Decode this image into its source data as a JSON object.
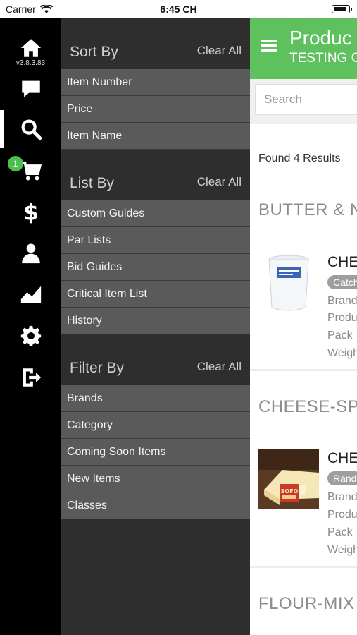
{
  "status_bar": {
    "carrier": "Carrier",
    "time": "6:45 CH"
  },
  "rail": {
    "version": "v3.8.3.83",
    "cart_badge": "1",
    "items": [
      {
        "icon": "home-icon"
      },
      {
        "icon": "chat-icon"
      },
      {
        "icon": "search-icon"
      },
      {
        "icon": "cart-icon"
      },
      {
        "icon": "dollar-icon"
      },
      {
        "icon": "user-icon"
      },
      {
        "icon": "chart-icon"
      },
      {
        "icon": "gear-icon"
      },
      {
        "icon": "logout-icon"
      }
    ]
  },
  "menu": {
    "sort_by": {
      "title": "Sort By",
      "clear": "Clear All",
      "items": [
        "Item Number",
        "Price",
        "Item Name"
      ]
    },
    "list_by": {
      "title": "List By",
      "clear": "Clear All",
      "items": [
        "Custom Guides",
        "Par Lists",
        "Bid Guides",
        "Critical Item List",
        "History"
      ]
    },
    "filter_by": {
      "title": "Filter By",
      "clear": "Clear All",
      "items": [
        "Brands",
        "Category",
        "Coming Soon Items",
        "New Items",
        "Classes"
      ]
    }
  },
  "header": {
    "title": "Produc",
    "subtitle": "TESTING C"
  },
  "search": {
    "placeholder": "Search"
  },
  "results": {
    "count_text": "Found 4 Results"
  },
  "categories": [
    "BUTTER & N",
    "CHEESE-SP",
    "FLOUR-MIX"
  ],
  "products": [
    {
      "name": "CHE",
      "tag": "Catch",
      "fields": [
        "Brand",
        "Produ",
        "Pack",
        "Weigh"
      ]
    },
    {
      "name": "CHE",
      "tag": "Rand",
      "fields": [
        "Brand",
        "Produ",
        "Pack",
        "Weigh"
      ]
    }
  ],
  "colors": {
    "accent": "#5ec15e",
    "badge": "#4cbf4f",
    "rail": "#000000",
    "menu_bg": "#2e2e2e",
    "menu_item": "#5a5a5a"
  }
}
